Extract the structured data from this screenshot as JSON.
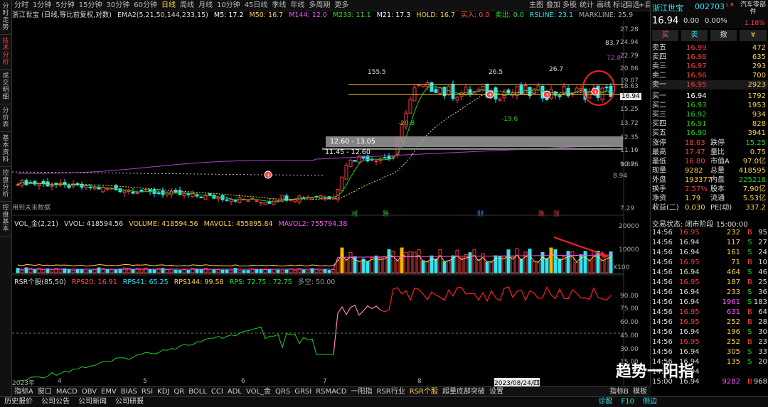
{
  "side_tabs": [
    "分时走势",
    "技术分析",
    "成交明细",
    "分价表",
    "基本资料",
    "控盘分析",
    "控盘基本"
  ],
  "periods": [
    "分时",
    "1分钟",
    "5分钟",
    "15分钟",
    "30分钟",
    "60分钟",
    "日线",
    "周线",
    "月线",
    "10分钟",
    "45日线",
    "季线",
    "年线",
    "多周期",
    "更多"
  ],
  "active_period": "日线",
  "tools": [
    "主图",
    "叠加",
    "多股",
    "统计",
    "画线",
    "标记",
    "-自选",
    "+自选"
  ],
  "info": {
    "title": "浙江世宝 (日线,等比前复权,对数)",
    "ema": "EMA2(5,21,50,144,233,15)",
    "m5": "M5: 17.2",
    "m50": "M50: 16.7",
    "m144": "M144: 12.0",
    "m233": "M233: 11.1",
    "m21": "M21: 17.3",
    "hold": "HOLD: 16.7",
    "buy": "买入: 0.0",
    "sell": "卖出: 0.0",
    "rsline": "RSLINE: 23.1",
    "mline": "MARKLINE: 25.9"
  },
  "right_header": {
    "name": "浙江世宝",
    "code": "002703",
    "flag": "L R",
    "industry": "汽车零部件",
    "price": "16.94",
    "change": "0.00",
    "pct": "0.00%",
    "up_ratio": "1.18%"
  },
  "right_buttons": [
    "买",
    "卖",
    "撤",
    "¥"
  ],
  "sells": [
    {
      "l": "卖五",
      "p": "16.99",
      "v": "472"
    },
    {
      "l": "卖四",
      "p": "16.98",
      "v": "635"
    },
    {
      "l": "卖三",
      "p": "16.97",
      "v": "293"
    },
    {
      "l": "卖二",
      "p": "16.96",
      "v": "700"
    },
    {
      "l": "卖一",
      "p": "16.95",
      "v": "2923"
    }
  ],
  "buys": [
    {
      "l": "买一",
      "p": "16.94",
      "v": "1792"
    },
    {
      "l": "买二",
      "p": "16.93",
      "v": "1953"
    },
    {
      "l": "买三",
      "p": "16.92",
      "v": "934"
    },
    {
      "l": "买四",
      "p": "16.91",
      "v": "828"
    },
    {
      "l": "买五",
      "p": "16.90",
      "v": "3941"
    }
  ],
  "quote": [
    [
      "涨停",
      "18.63",
      "跌停",
      "15.25"
    ],
    [
      "最高",
      "17.47",
      "量比",
      "0.75"
    ],
    [
      "最低",
      "16.80",
      "市值A",
      "97.0亿"
    ],
    [
      "现量",
      "9282",
      "总量",
      "418595"
    ],
    [
      "外盘",
      "193377",
      "内盘",
      "225218"
    ],
    [
      "换手",
      "7.57%",
      "股本",
      "7.90亿"
    ],
    [
      "净资",
      "1.79",
      "流通",
      "5.53亿"
    ],
    [
      "收益(二)",
      "0.030",
      "PE(动)",
      "337.2"
    ]
  ],
  "trade_status": "交易状态: 闭市阶段 15:00:00",
  "ticks": [
    [
      "14:56",
      "16.95",
      "232",
      "B",
      "95"
    ],
    [
      "14:56",
      "16.94",
      "117",
      "S",
      "27"
    ],
    [
      "14:56",
      "16.94",
      "161",
      "S",
      "24"
    ],
    [
      "14:56",
      "16.95",
      "71",
      "B",
      "10"
    ],
    [
      "14:56",
      "16.94",
      "464",
      "S",
      "46"
    ],
    [
      "14:56",
      "16.95",
      "187",
      "B",
      "25"
    ],
    [
      "14:56",
      "16.94",
      "233",
      "S",
      "36"
    ],
    [
      "14:56",
      "16.94",
      "1961",
      "S",
      "183"
    ],
    [
      "14:56",
      "16.95",
      "631",
      "B",
      "64"
    ],
    [
      "14:56",
      "16.95",
      "252",
      "B",
      "28"
    ],
    [
      "14:56",
      "16.94",
      "196",
      "S",
      "30"
    ],
    [
      "14:56",
      "16.95",
      "252",
      "B",
      "23"
    ],
    [
      "14:56",
      "16.94",
      "305",
      "S",
      "33"
    ],
    [
      "14:56",
      "16.94",
      "135",
      "S",
      "20"
    ],
    [
      "14:56",
      "16.94",
      "",
      "",
      ""
    ],
    [
      "15:00",
      "16.94",
      "9282",
      "B",
      "968"
    ]
  ],
  "y_axis": [
    "27.28",
    "24.94",
    "22.79",
    "20.86",
    "19.07",
    "18.63",
    "17.48",
    "16.94",
    "15.25",
    "13.72",
    "12.35",
    "11.16",
    "10.06",
    "9.87",
    "8.94",
    "7.29"
  ],
  "labels": {
    "hi1": "155.5",
    "hi2": "26.5",
    "hi3": "26.7",
    "lo1": "-20.8",
    "lo2": "-19.6",
    "r837": "83.7",
    "r728": "72.8",
    "box1": "12.60 - 13.05",
    "box2": "11.45 - 12.60",
    "future": "用到未来数据",
    "m1": "减",
    "m2": "跌",
    "m3": "财",
    "m4": "跌",
    "m5": "涨"
  },
  "vol_info": {
    "name": "VOL_金(2,21)",
    "vvol": "VVOL: 418594.56",
    "volume": "VOLUME: 418594.56",
    "mavol1": "MAVOL1: 455895.84",
    "mavol2": "MAVOL2: 755794.38"
  },
  "vol_axis": [
    "20000",
    "10000",
    "X100"
  ],
  "rsr_info": {
    "name": "RSR个股(85,50)",
    "rps20": "RPS20: 16.91",
    "rps41": "RPS41: 65.25",
    "rps144": "RPS144: 99.58",
    "rps": "RPS: 72.75 : 72.75",
    "dk": "多空: 50.00"
  },
  "rsr_axis": [
    "90.00",
    "75.00",
    "60.00",
    "45.00",
    "30.00",
    "15.00"
  ],
  "x_axis": [
    "2023年",
    "4",
    "5",
    "6",
    "7",
    "8",
    "2023/08/24/四"
  ],
  "bottom_tabs": [
    "指标A",
    "窗口",
    "MACD",
    "OBV",
    "EMV",
    "BIAS",
    "RSI",
    "KDJ",
    "QR",
    "BOLL",
    "CCI",
    "ADL",
    "VOL_金",
    "QRS",
    "GRSI",
    "RSMACD",
    "一阳指",
    "RSR行业",
    "RSR个股",
    "超量底部突破",
    "设置"
  ],
  "bottom_tabs_active": "RSR个股",
  "bottom_right": [
    "指标B",
    "模板"
  ],
  "status": [
    "历史报价",
    "公司公告",
    "公司新闻",
    "公司研报"
  ],
  "status_right": [
    "诊股",
    "F10",
    "侧边"
  ],
  "watermark": "趋势一阳指",
  "colors": {
    "up": "#ff3b3b",
    "down": "#2ee6f0",
    "yellow": "#ffd24a",
    "magenta": "#c040c0",
    "green": "#22cc22"
  }
}
